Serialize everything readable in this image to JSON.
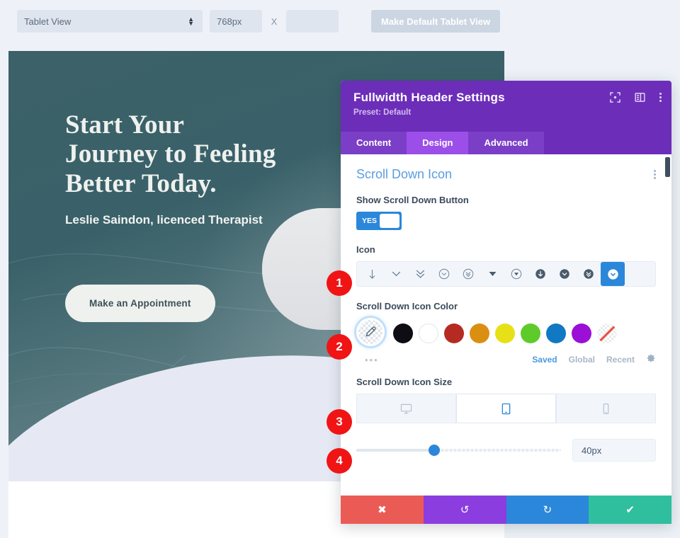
{
  "toolbar": {
    "viewport_select": "Tablet View",
    "width_value": "768px",
    "x_label": "X",
    "height_value": "",
    "make_default_label": "Make Default Tablet View"
  },
  "preview": {
    "headline": "Start Your Journey to Feeling Better Today.",
    "subheadline": "Leslie Saindon, licenced Therapist",
    "cta_label": "Make an Appointment"
  },
  "modal": {
    "title": "Fullwidth Header Settings",
    "preset": "Preset: Default",
    "header_icons": [
      "focus-icon",
      "layout-icon",
      "kebab-icon"
    ],
    "tabs": [
      {
        "label": "Content",
        "active": false
      },
      {
        "label": "Design",
        "active": true
      },
      {
        "label": "Advanced",
        "active": false
      }
    ],
    "section": {
      "title": "Scroll Down Icon",
      "toggle": {
        "label": "Show Scroll Down Button",
        "value": "YES"
      },
      "icon_field": {
        "label": "Icon",
        "options": [
          "arrow-down-icon",
          "chevron-down-icon",
          "double-chevron-down-icon",
          "circle-chevron-down-outline-icon",
          "circle-double-chevron-down-outline-icon",
          "caret-down-small-icon",
          "circle-caret-down-outline-icon",
          "circle-arrow-down-filled-icon",
          "circle-chevron-down-filled-icon",
          "circle-double-chevron-down-filled-icon",
          "circle-chevron-down-selected-icon"
        ],
        "selected_index": 10
      },
      "color_field": {
        "label": "Scroll Down Icon Color",
        "eyedropper": "eyedropper-icon",
        "more_label": "•••",
        "swatches": [
          "#0d0d13",
          "#ffffff",
          "#b52b22",
          "#db8f12",
          "#e8e017",
          "#5ecb2a",
          "#1178c4",
          "#9b0fd6",
          "none"
        ],
        "palette_tabs": [
          {
            "label": "Saved",
            "active": true
          },
          {
            "label": "Global",
            "active": false
          },
          {
            "label": "Recent",
            "active": false
          }
        ],
        "settings_icon": "gear-icon"
      },
      "size_field": {
        "label": "Scroll Down Icon Size",
        "devices": [
          {
            "name": "desktop-icon",
            "active": false
          },
          {
            "name": "tablet-icon",
            "active": true
          },
          {
            "name": "phone-icon",
            "active": false
          }
        ],
        "slider_value": "40px",
        "slider_percent": 38
      }
    },
    "footer_buttons": [
      {
        "name": "cancel-button",
        "glyph": "✖",
        "color": "#eb5b55"
      },
      {
        "name": "undo-button",
        "glyph": "↺",
        "color": "#8b3ddf"
      },
      {
        "name": "redo-button",
        "glyph": "↻",
        "color": "#2b87da"
      },
      {
        "name": "save-button",
        "glyph": "✔",
        "color": "#2fbf9e"
      }
    ]
  },
  "callouts": [
    {
      "number": "1"
    },
    {
      "number": "2"
    },
    {
      "number": "3"
    },
    {
      "number": "4"
    }
  ]
}
